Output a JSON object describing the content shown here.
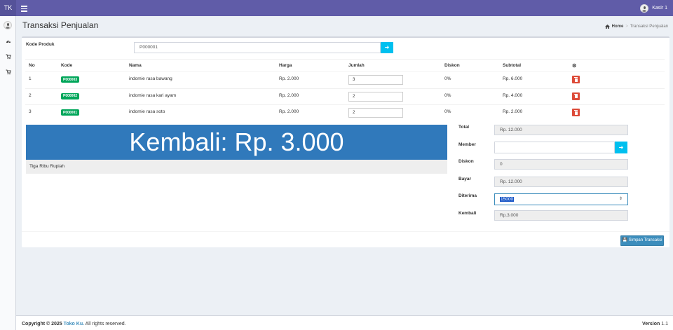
{
  "navbar": {
    "brand": "TK",
    "user_name": "Kasir 1"
  },
  "sidebar": {
    "icons": [
      "dashboard-icon",
      "cart-icon",
      "cart-icon"
    ]
  },
  "page": {
    "title": "Transaksi Penjualan"
  },
  "breadcrumb": {
    "home": "Home",
    "current": "Transaksi Penjualan"
  },
  "form": {
    "kode_label": "Kode Produk",
    "kode_value": "P000001"
  },
  "table": {
    "headers": {
      "no": "No",
      "kode": "Kode",
      "nama": "Nama",
      "harga": "Harga",
      "jumlah": "Jumlah",
      "diskon": "Diskon",
      "subtotal": "Subtotal"
    },
    "rows": [
      {
        "no": "1",
        "kode": "P000003",
        "nama": "indomie rasa bawang",
        "harga": "Rp. 2.000",
        "jumlah": "3",
        "diskon": "0%",
        "subtotal": "Rp. 6.000"
      },
      {
        "no": "2",
        "kode": "P000002",
        "nama": "indomie rasa kari ayam",
        "harga": "Rp. 2.000",
        "jumlah": "2",
        "diskon": "0%",
        "subtotal": "Rp. 4.000"
      },
      {
        "no": "3",
        "kode": "P000001",
        "nama": "indomie rasa soto",
        "harga": "Rp. 2.000",
        "jumlah": "2",
        "diskon": "0%",
        "subtotal": "Rp. 2.000"
      }
    ]
  },
  "summary": {
    "banner": "Kembali: Rp. 3.000",
    "terbilang": "Tiga Ribu Rupiah",
    "total_label": "Total",
    "total_value": "Rp. 12.000",
    "member_label": "Member",
    "member_value": "",
    "diskon_label": "Diskon",
    "diskon_value": "0",
    "bayar_label": "Bayar",
    "bayar_value": "Rp. 12.000",
    "diterima_label": "Diterima",
    "diterima_value": "15000",
    "kembali_label": "Kembali",
    "kembali_value": "Rp.3.000"
  },
  "actions": {
    "save_label": "Simpan Transaksi"
  },
  "footer": {
    "copyright": "Copyright © 2025",
    "brand": "Toko Ku.",
    "rights": "All rights reserved.",
    "version_label": "Version",
    "version": "1.1"
  },
  "colors": {
    "navbar": "#605ca8",
    "banner": "#3079bb",
    "accent": "#00c0ef",
    "danger": "#dd4b39",
    "success": "#00a65a"
  }
}
